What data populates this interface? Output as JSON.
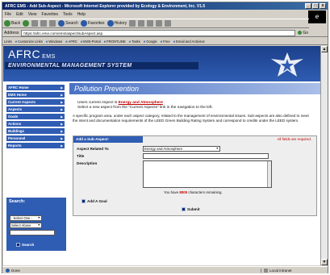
{
  "window": {
    "title": "AFRC EMS - Add Sub-Aspect - Microsoft Internet Explorer provided by Ecology & Environment, Inc. V1.5",
    "controls": [
      "_",
      "□",
      "x"
    ]
  },
  "menu": [
    "File",
    "Edit",
    "View",
    "Favorites",
    "Tools",
    "Help"
  ],
  "toolbar": {
    "back": "Back",
    "search": "Search",
    "favorites": "Favorites",
    "history": "History"
  },
  "address": {
    "label": "Address",
    "url": "https://afrc.eme.com/ems/aspect/subAspect.asp",
    "go": "Go"
  },
  "links": [
    "Links",
    "Customize Links",
    "Windows",
    "AFRC",
    "EMS-Portal",
    "FRONTLINE",
    "Tasks",
    "Google",
    "Free",
    "Email and Antivirus"
  ],
  "header": {
    "logo": "AFRC",
    "logo_sub": "EMS",
    "system": "ENVIRONMENTAL MANAGEMENT SYSTEM",
    "page_title": "Pollution Prevention"
  },
  "sidebar": {
    "items": [
      "AFRC Home",
      "EMS Home",
      "Current Aspects",
      "Aspects",
      "Goals",
      "Actions",
      "Buildings",
      "Personnel",
      "Reports"
    ],
    "search": {
      "title": "Search:",
      "select_one": "- Select One -",
      "select_above": "Select Above",
      "button": "Search"
    }
  },
  "main": {
    "current_prefix": "Users current Aspect is",
    "current_value": "Energy and Atmosphere",
    "select_new": "Select a new aspect from the \"Current Aspects\" link in the navigation to the left.",
    "description": "A specific program area, under each aspect category, related to the management of environmental issues. Sub-aspects are also defined to meet the intent and documentation requirements of the LEED Green Building Rating System and correspond to credits under the LEED system."
  },
  "form": {
    "header": "Add a Sub-Aspect:",
    "required": "All fields are required.",
    "aspect_label": "Aspect Related To",
    "aspect_value": "Energy and Atmosphere",
    "title_label": "Title",
    "description_label": "Description",
    "chars_prefix": "You have",
    "chars_count": "8000",
    "chars_suffix": "characters remaining.",
    "add_goal": "Add A Goal",
    "submit": "Submit"
  },
  "status": {
    "done": "Done",
    "zone": "Local intranet"
  },
  "colors": {
    "brand_blue": "#2f5db3",
    "dark_blue": "#0e2a66",
    "accent_red": "#c00000"
  }
}
